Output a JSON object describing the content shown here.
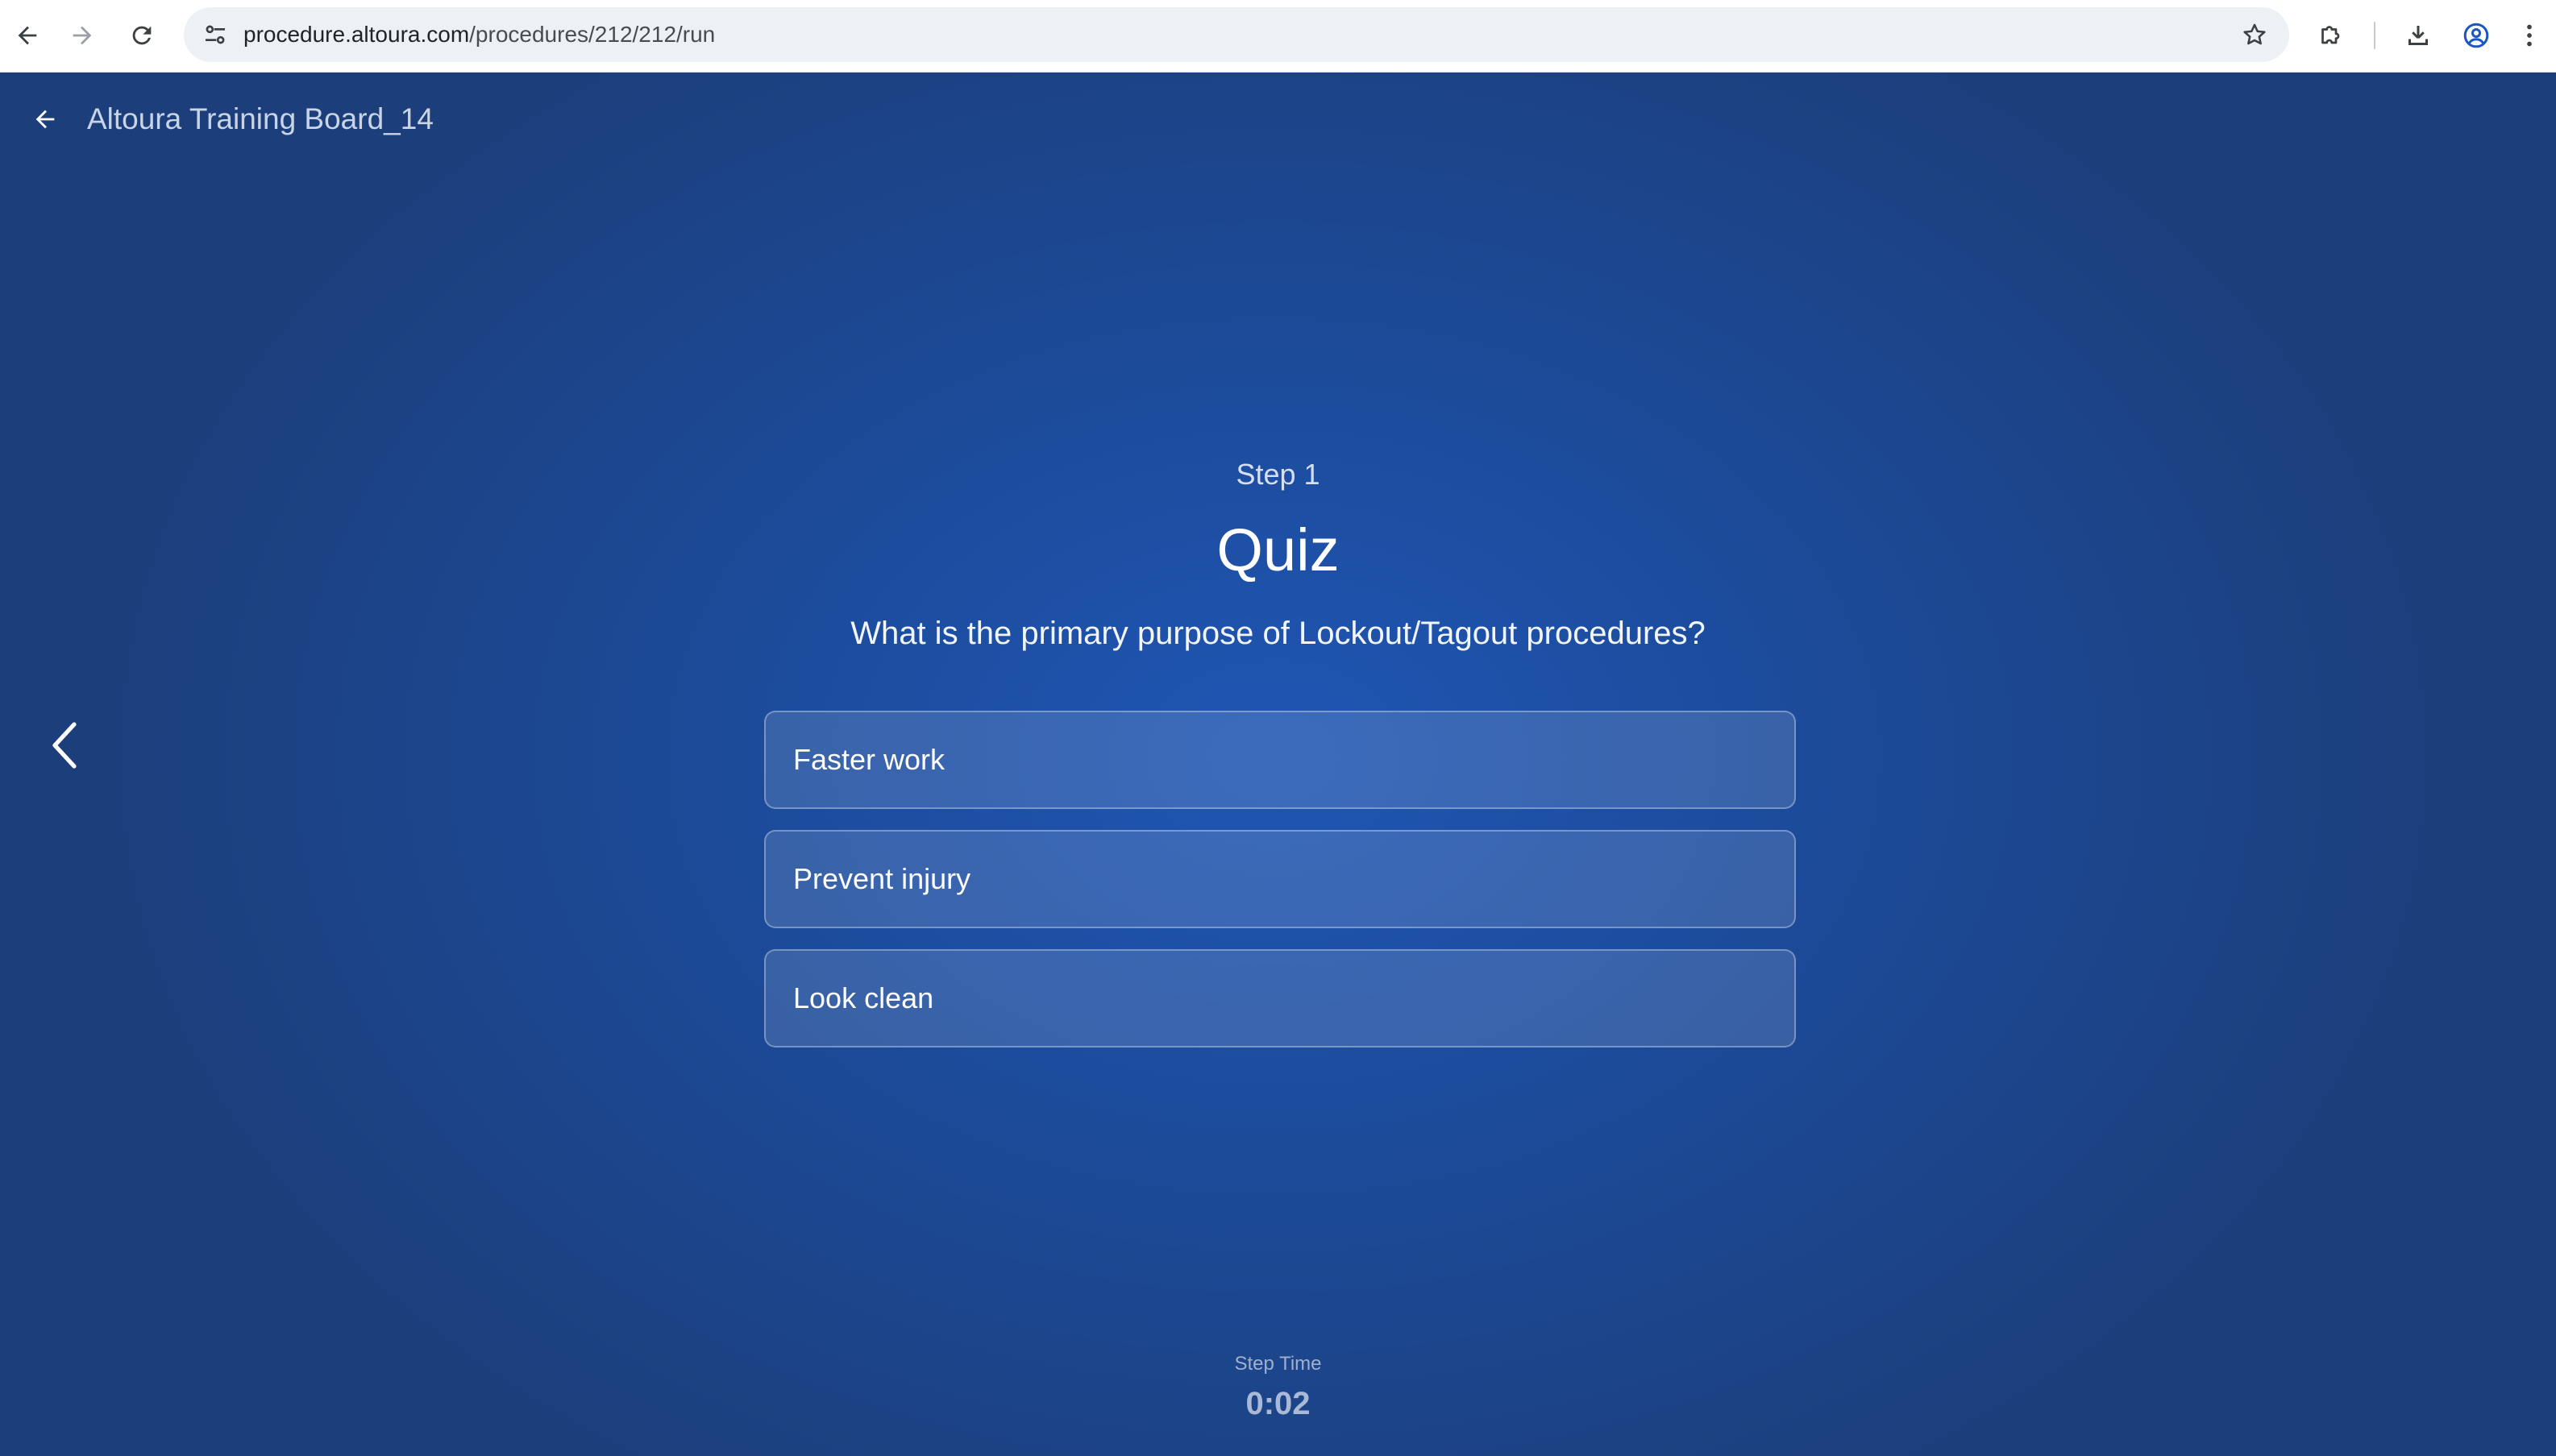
{
  "browser": {
    "url_host": "procedure.altoura.com",
    "url_path": "/procedures/212/212/run",
    "icons": {
      "back": "arrow-left-icon",
      "forward": "arrow-right-icon",
      "reload": "reload-icon",
      "site_info": "tune-icon",
      "bookmark": "star-icon",
      "extensions": "puzzle-icon",
      "downloads": "download-icon",
      "profile": "account-circle-icon",
      "menu": "kebab-menu-icon"
    }
  },
  "header": {
    "board_title": "Altoura Training Board_14"
  },
  "step": {
    "label": "Step 1",
    "title": "Quiz",
    "question": "What is the primary purpose of Lockout/Tagout procedures?",
    "options": [
      {
        "label": "Faster work"
      },
      {
        "label": "Prevent injury"
      },
      {
        "label": "Look clean"
      }
    ]
  },
  "timer": {
    "label": "Step Time",
    "value": "0:02"
  },
  "colors": {
    "background_center": "#1f56b4",
    "background_edge": "#1c3f7c",
    "option_border": "rgba(255,255,255,0.32)",
    "profile_icon": "#1a56c4"
  }
}
